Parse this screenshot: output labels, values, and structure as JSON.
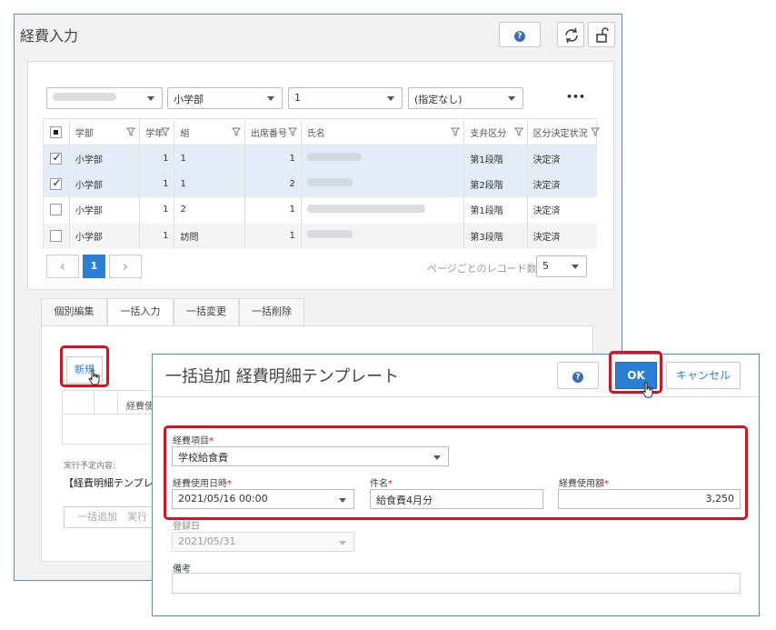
{
  "window": {
    "title": "経費入力",
    "help_label": "?"
  },
  "filters": {
    "dept": "小学部",
    "grade": "1",
    "class": "(指定なし)",
    "more": "•••"
  },
  "table": {
    "headers": [
      "学部",
      "学年",
      "組",
      "出席番号",
      "氏名",
      "支弁区分",
      "区分決定状況"
    ],
    "rows": [
      {
        "dept": "小学部",
        "grade": "1",
        "class": "1",
        "no": "1",
        "support": "第1段階",
        "status": "決定済",
        "checked": true
      },
      {
        "dept": "小学部",
        "grade": "1",
        "class": "1",
        "no": "2",
        "support": "第2段階",
        "status": "決定済",
        "checked": true
      },
      {
        "dept": "小学部",
        "grade": "1",
        "class": "2",
        "no": "1",
        "support": "第1段階",
        "status": "決定済",
        "checked": false
      },
      {
        "dept": "小学部",
        "grade": "1",
        "class": "訪問",
        "no": "1",
        "support": "第3段階",
        "status": "決定済",
        "checked": false
      }
    ]
  },
  "pager": {
    "prev": "‹",
    "page": "1",
    "next": "›",
    "per_page_label": "ページごとのレコード数",
    "per_page": "5"
  },
  "tabs": [
    "個別編集",
    "一括入力",
    "一括変更",
    "一括削除"
  ],
  "bulk": {
    "new_label": "新規",
    "col_label": "経費使",
    "exec_label": "実行予定内容:",
    "exec_value": "【経費明細テンプレー",
    "exec_button": "一括追加　実行"
  },
  "dialog": {
    "title": "一括追加 経費明細テンプレート",
    "help_label": "?",
    "ok": "OK",
    "cancel": "キャンセル",
    "fields": {
      "item_label": "経費項目",
      "item_value": "学校給食費",
      "date_label": "経費使用日時",
      "date_value": "2021/05/16 00:00",
      "subject_label": "件名",
      "subject_value": "給食費4月分",
      "amount_label": "経費使用額",
      "amount_value": "3,250",
      "reg_label": "登録日",
      "reg_value": "2021/05/31",
      "memo_label": "備考",
      "memo_value": "",
      "required_mark": "*"
    }
  },
  "colors": {
    "accent": "#2a7fd4",
    "highlight": "#e00d1a",
    "row_selected": "#e3edf8"
  }
}
